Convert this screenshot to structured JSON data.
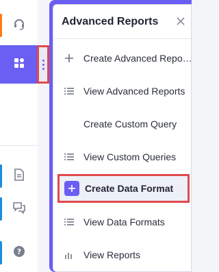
{
  "rail": {
    "icons": [
      {
        "name": "headset-icon",
        "color": "#ff7a1a"
      },
      {
        "name": "dashboard-icon",
        "active": true
      },
      {
        "name": "document-icon",
        "color": "#1a8de0"
      },
      {
        "name": "chat-icon",
        "color": "#1a8de0"
      },
      {
        "name": "help-icon",
        "color": "#1a8de0"
      }
    ]
  },
  "panel": {
    "title": "Advanced Reports",
    "items": [
      {
        "label": "Create Advanced Reports",
        "icon": "plus-icon"
      },
      {
        "label": "View Advanced Reports",
        "icon": "list-icon"
      },
      {
        "label": "Create Custom Query",
        "icon": ""
      },
      {
        "label": "View Custom Queries",
        "icon": "list-icon"
      },
      {
        "label": "Create Data Format",
        "icon": "plus-icon",
        "highlighted": true
      },
      {
        "label": "View Data Formats",
        "icon": "list-icon"
      },
      {
        "label": "View Reports",
        "icon": "bar-chart-icon"
      }
    ]
  },
  "colors": {
    "accent": "#6a5ef3",
    "highlight_border": "#e0494b"
  }
}
